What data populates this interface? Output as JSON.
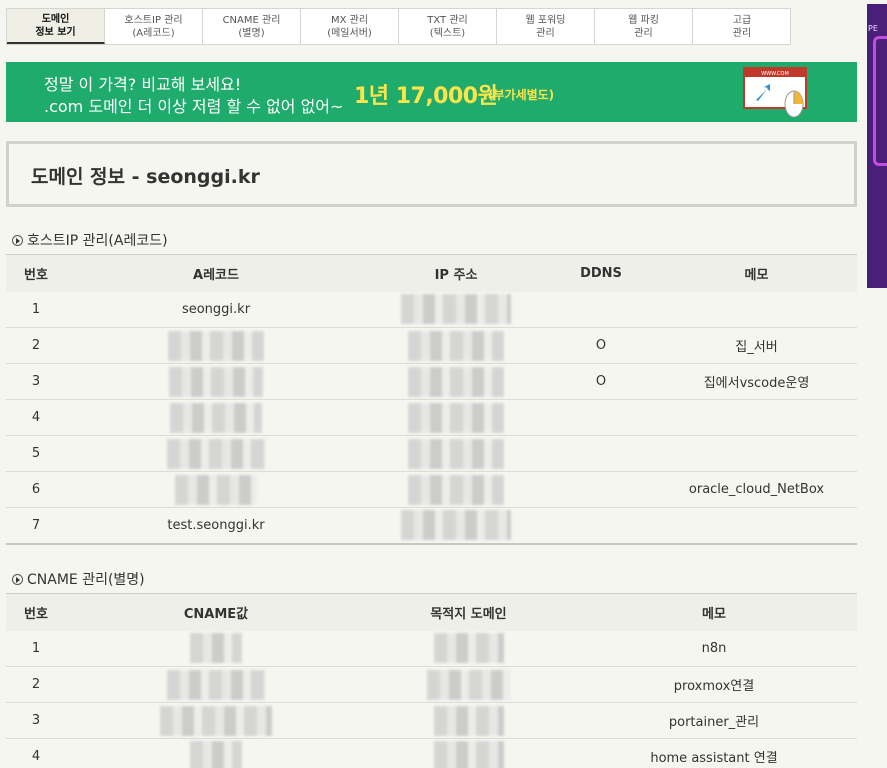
{
  "tabs": [
    {
      "line1": "도메인",
      "line2": "정보 보기",
      "active": true
    },
    {
      "line1": "호스트IP 관리",
      "line2": "(A레코드)"
    },
    {
      "line1": "CNAME 관리",
      "line2": "(별명)"
    },
    {
      "line1": "MX 관리",
      "line2": "(메일서버)"
    },
    {
      "line1": "TXT 관리",
      "line2": "(텍스트)"
    },
    {
      "line1": "웹 포워딩",
      "line2": "관리"
    },
    {
      "line1": "웹 파킹",
      "line2": "관리"
    },
    {
      "line1": "고급",
      "line2": "관리"
    }
  ],
  "banner": {
    "line1": "정말 이 가격? 비교해 보세요!",
    "line2": ".com 도메인 더 이상 저렴 할 수 없어 없어~",
    "price": "1년 17,000원",
    "vat": "(부가세별도)",
    "illus_text": "WWW.COM"
  },
  "side_ad": {
    "label": "PE"
  },
  "page_title": "도메인 정보 - seonggi.kr",
  "a_records": {
    "title": "호스트IP 관리(A레코드)",
    "headers": [
      "번호",
      "A레코드",
      "IP 주소",
      "DDNS",
      "메모"
    ],
    "rows": [
      {
        "no": "1",
        "record": "seonggi.kr",
        "ddns": "",
        "memo": ""
      },
      {
        "no": "2",
        "record": "",
        "ddns": "O",
        "memo": "집_서버"
      },
      {
        "no": "3",
        "record": "",
        "ddns": "O",
        "memo": "집에서vscode운영"
      },
      {
        "no": "4",
        "record": "",
        "ddns": "",
        "memo": ""
      },
      {
        "no": "5",
        "record": "",
        "ddns": "",
        "memo": ""
      },
      {
        "no": "6",
        "record": "",
        "ddns": "",
        "memo": "oracle_cloud_NetBox"
      },
      {
        "no": "7",
        "record": "test.seonggi.kr",
        "ddns": "",
        "memo": ""
      }
    ]
  },
  "cname": {
    "title": "CNAME 관리(별명)",
    "headers": [
      "번호",
      "CNAME값",
      "목적지 도메인",
      "메모"
    ],
    "rows": [
      {
        "no": "1",
        "memo": "n8n"
      },
      {
        "no": "2",
        "memo": "proxmox연결"
      },
      {
        "no": "3",
        "memo": "portainer_관리"
      },
      {
        "no": "4",
        "memo": "home assistant 연결"
      }
    ]
  },
  "colors": {
    "banner_bg": "#1eab6c",
    "price": "#ffe34a",
    "page_bg": "#f6f6f0"
  }
}
